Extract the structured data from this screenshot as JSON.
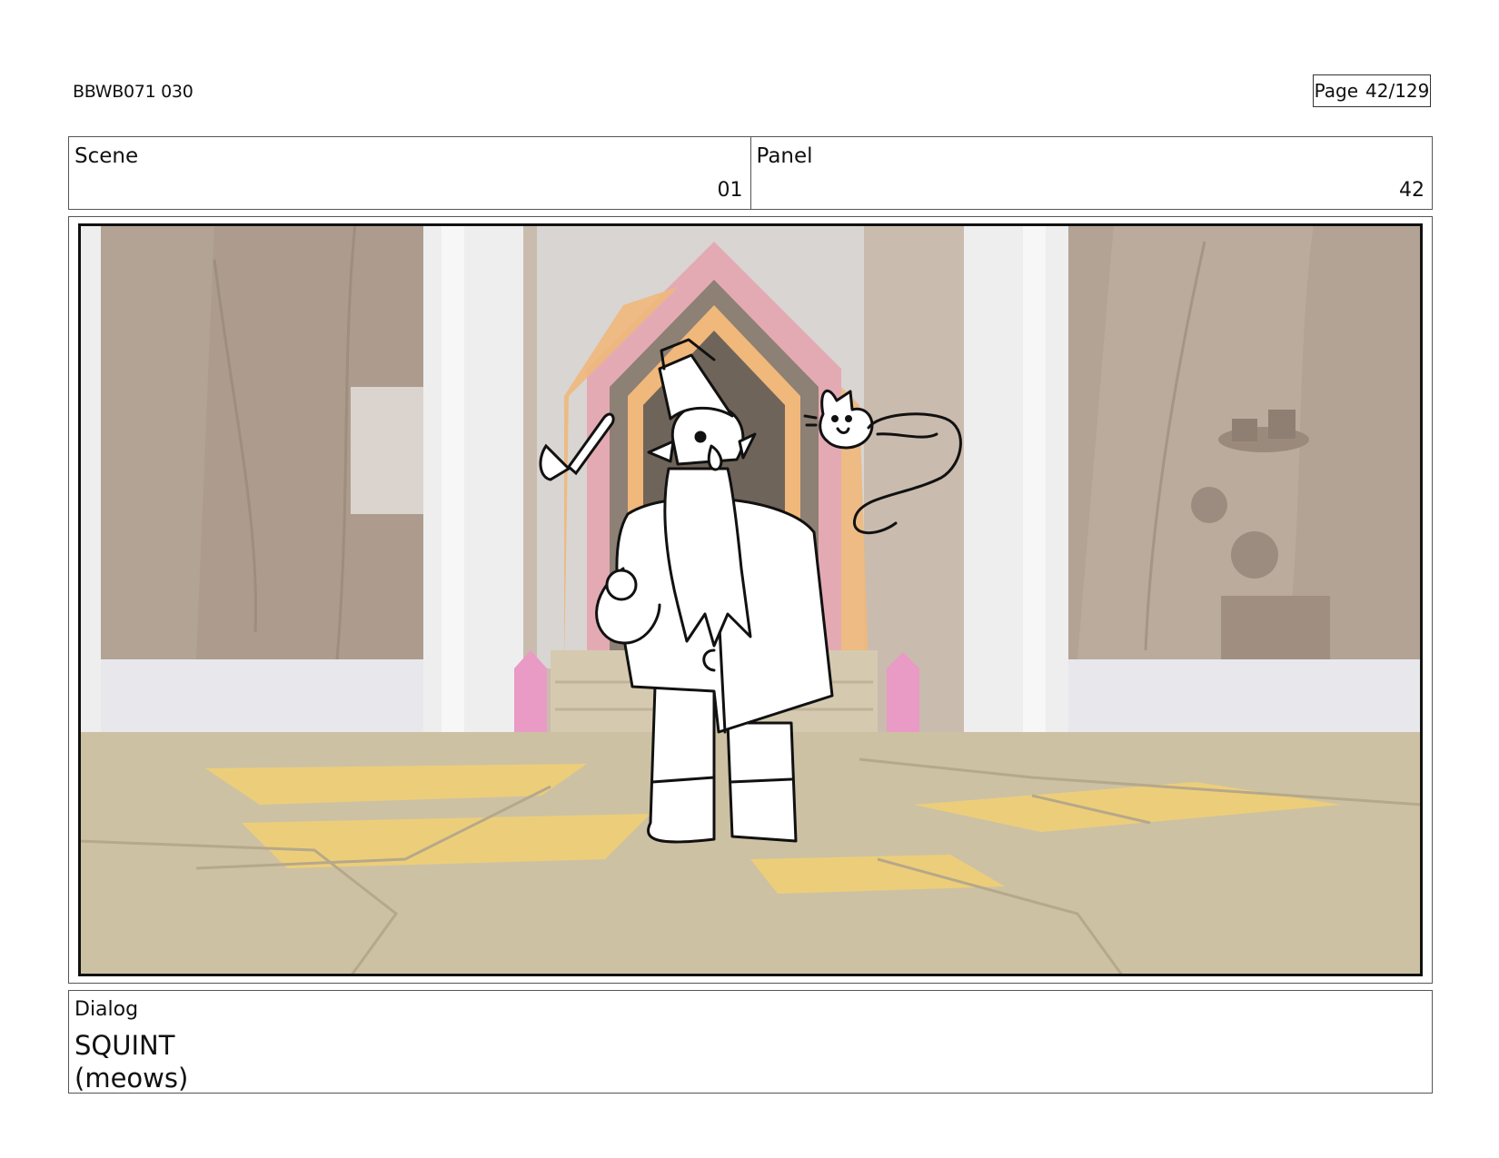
{
  "header": {
    "doc_id": "BBWB071 030",
    "page_label": "Page",
    "page_value": "42/129"
  },
  "info": {
    "scene_label": "Scene",
    "scene_value": "01",
    "panel_label": "Panel",
    "panel_value": "42"
  },
  "dialog": {
    "label": "Dialog",
    "lines": [
      "SQUINT",
      "(meows)"
    ]
  },
  "colors": {
    "wall": "#b3a394",
    "pillar": "#eeeeef",
    "floor": "#cdc1a3",
    "floor_highlight": "#ecce7a",
    "door_pink": "#e4aab4",
    "door_orange": "#f0b87a",
    "door_dark": "#8d8074",
    "crystal": "#e99ac5",
    "line": "#111111"
  }
}
